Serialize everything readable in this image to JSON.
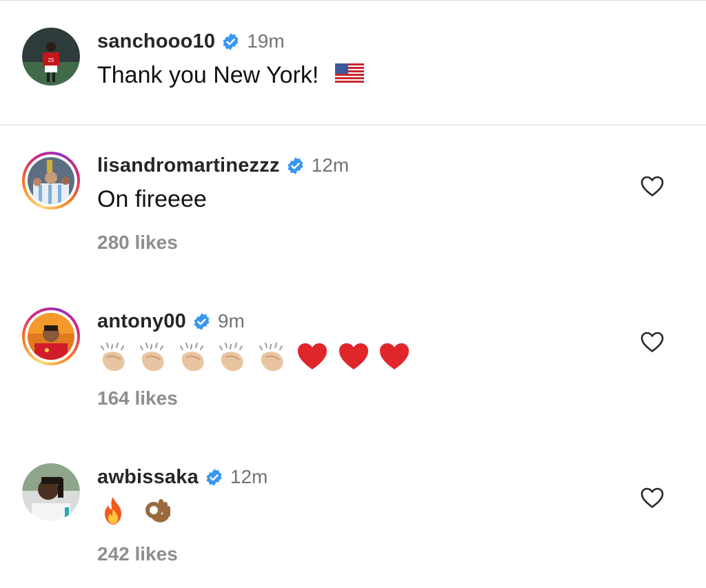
{
  "caption": {
    "username": "sanchooo10",
    "time": "19m",
    "text": "Thank you New York!",
    "flag_icon": "us-flag-emoji"
  },
  "comments": [
    {
      "username": "lisandromartinezzz",
      "time": "12m",
      "text": "On fireeee",
      "likes": "280 likes",
      "has_story_ring": true
    },
    {
      "username": "antony00",
      "time": "9m",
      "text": "",
      "emoji": [
        "clapping-hands",
        "clapping-hands",
        "clapping-hands",
        "clapping-hands",
        "clapping-hands",
        "red-heart",
        "red-heart",
        "red-heart"
      ],
      "likes": "164 likes",
      "has_story_ring": true
    },
    {
      "username": "awbissaka",
      "time": "12m",
      "text": "",
      "emoji": [
        "fire",
        "ok-hand"
      ],
      "likes": "242 likes",
      "has_story_ring": false
    }
  ],
  "colors": {
    "verified_blue": "#3897f0",
    "likes_gray": "#8e8e8e",
    "time_gray": "#737373"
  }
}
